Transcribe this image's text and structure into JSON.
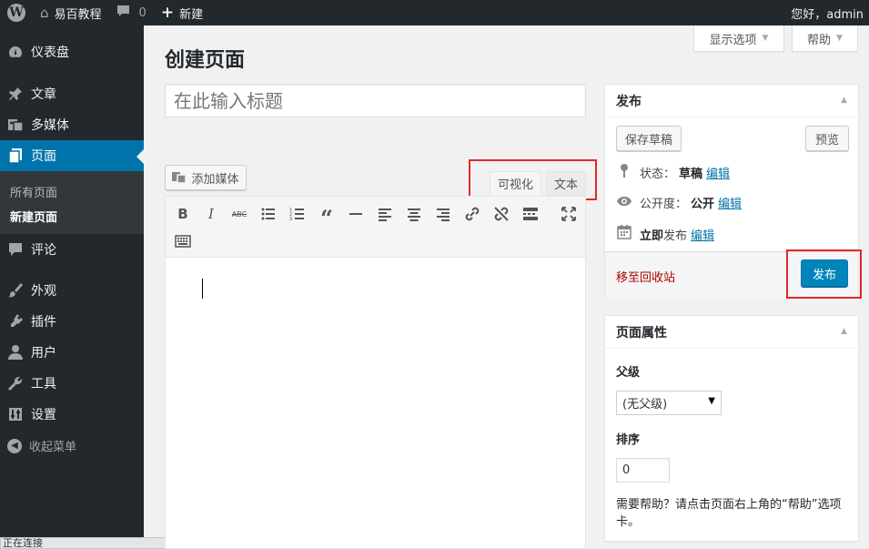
{
  "adminbar": {
    "site_name": "易百教程",
    "comments_count": "0",
    "new_label": "新建",
    "greeting": "您好，admin"
  },
  "sidebar": {
    "items": [
      {
        "label": "仪表盘",
        "icon": "dashboard-icon"
      },
      {
        "label": "文章",
        "icon": "pin-icon"
      },
      {
        "label": "多媒体",
        "icon": "media-icon"
      },
      {
        "label": "页面",
        "icon": "pages-icon"
      },
      {
        "label": "评论",
        "icon": "comment-icon"
      },
      {
        "label": "外观",
        "icon": "brush-icon"
      },
      {
        "label": "插件",
        "icon": "plugin-icon"
      },
      {
        "label": "用户",
        "icon": "user-icon"
      },
      {
        "label": "工具",
        "icon": "wrench-icon"
      },
      {
        "label": "设置",
        "icon": "settings-icon"
      }
    ],
    "submenu": [
      "所有页面",
      "新建页面"
    ],
    "collapse_label": "收起菜单"
  },
  "screen_options": {
    "display_label": "显示选项",
    "help_label": "帮助"
  },
  "page_title": "创建页面",
  "title_placeholder": "在此输入标题",
  "editor": {
    "add_media_label": "添加媒体",
    "tab_visual": "可视化",
    "tab_text": "文本"
  },
  "publish_box": {
    "title": "发布",
    "save_draft": "保存草稿",
    "preview": "预览",
    "status_label": "状态：",
    "status_value": "草稿",
    "visibility_label": "公开度：",
    "visibility_value": "公开",
    "schedule_value": "立即",
    "schedule_label": "发布",
    "edit_link": "编辑",
    "trash": "移至回收站",
    "publish": "发布"
  },
  "page_attributes": {
    "title": "页面属性",
    "parent_label": "父级",
    "parent_value": "(无父级)",
    "order_label": "排序",
    "order_value": "0",
    "help_text": "需要帮助？请点击页面右上角的“帮助”选项卡。"
  },
  "status_bar_text": "正在连接",
  "colors": {
    "accent": "#0073aa",
    "publish": "#0085ba",
    "highlight": "#e0282a",
    "admin_bg": "#23282d"
  }
}
